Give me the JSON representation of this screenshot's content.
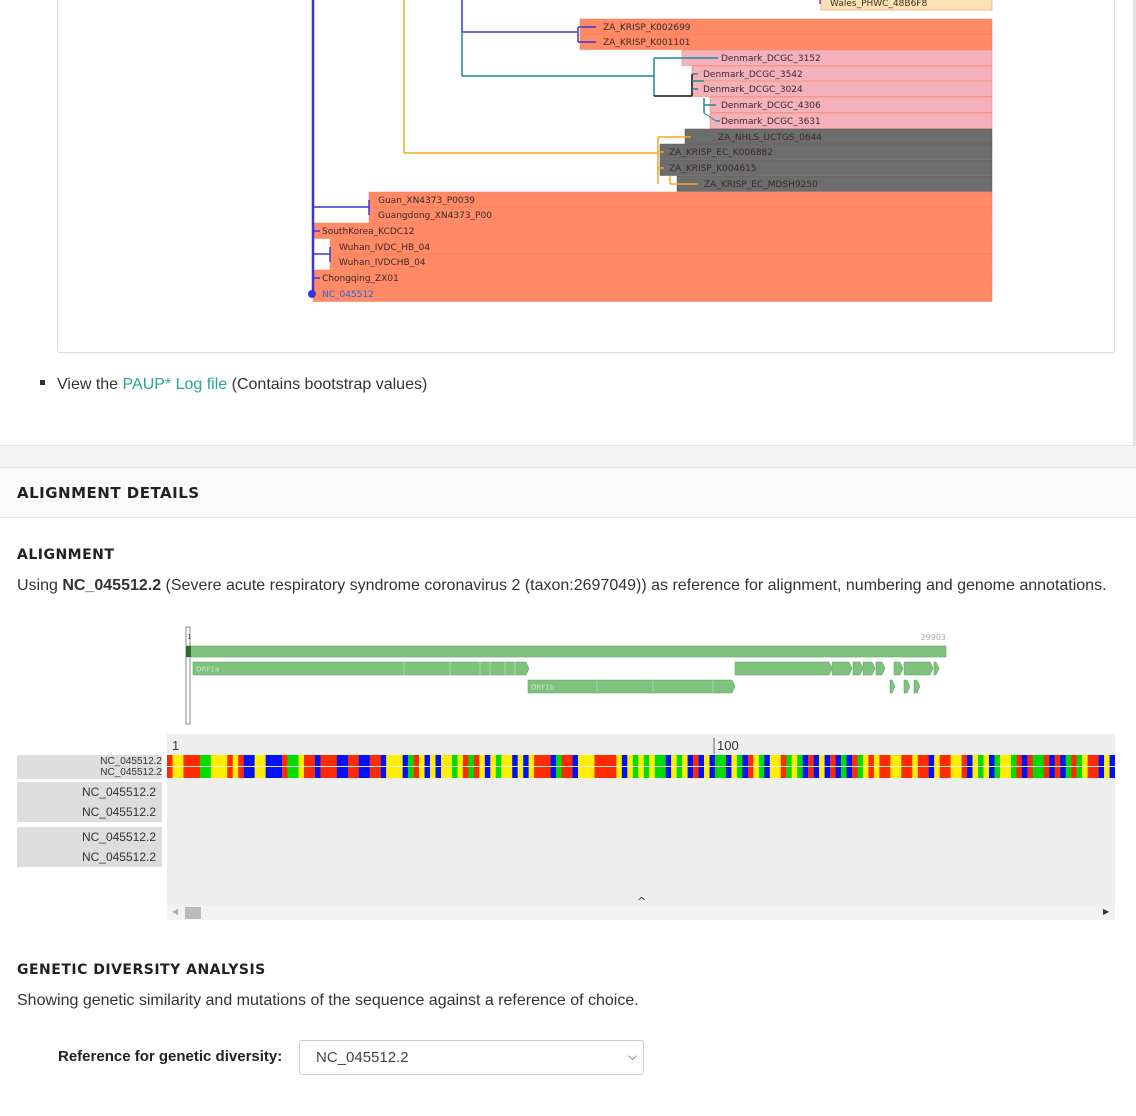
{
  "tree": {
    "leaves": [
      {
        "label": "Wales_PHWC_48B6F8",
        "color": "#fde3b0"
      },
      {
        "label": "ZA_KRISP_K002699",
        "color": "#ff8a65"
      },
      {
        "label": "ZA_KRISP_K001101",
        "color": "#ff8a65"
      },
      {
        "label": "Denmark_DCGC_3152",
        "color": "#f4b1bb"
      },
      {
        "label": "Denmark_DCGC_3542",
        "color": "#f4b1bb"
      },
      {
        "label": "Denmark_DCGC_3024",
        "color": "#f4b1bb"
      },
      {
        "label": "Denmark_DCGC_4306",
        "color": "#f4b1bb"
      },
      {
        "label": "Denmark_DCGC_3631",
        "color": "#f4b1bb"
      },
      {
        "label": "ZA_NHLS_UCTGS_0644",
        "color": "#6d6d6d"
      },
      {
        "label": "ZA_KRISP_EC_K006882",
        "color": "#6d6d6d"
      },
      {
        "label": "ZA_KRISP_K004615",
        "color": "#6d6d6d"
      },
      {
        "label": "ZA_KRISP_EC_MDSH9250",
        "color": "#6d6d6d"
      },
      {
        "label": "Guan_XN4373_P0039",
        "color": "#ff8a65"
      },
      {
        "label": "Guangdong_XN4373_P00",
        "color": "#ff8a65"
      },
      {
        "label": "SouthKorea_KCDC12",
        "color": "#ff8a65"
      },
      {
        "label": "Wuhan_IVDC_HB_04",
        "color": "#ff8a65"
      },
      {
        "label": "Wuhan_IVDCHB_04",
        "color": "#ff8a65"
      },
      {
        "label": "Chongqing_ZX01",
        "color": "#ff8a65"
      },
      {
        "label": "NC_045512",
        "color": "#ff8a65"
      }
    ]
  },
  "paup": {
    "prefix": "View the ",
    "link": "PAUP* Log file",
    "suffix": " (Contains bootstrap values)"
  },
  "alignment_details": {
    "header": "ALIGNMENT DETAILS",
    "alignment_title": "ALIGNMENT",
    "desc_prefix": "Using ",
    "desc_ref": "NC_045512.2",
    "desc_suffix": " (Severe acute respiratory syndrome coronavirus 2 (taxon:2697049)) as reference for alignment, numbering and genome annotations."
  },
  "genome_map": {
    "start_label": "1",
    "end_label": "29903",
    "genes": [
      "ORF1a",
      "ORF1b"
    ]
  },
  "msa": {
    "ruler_start": "1",
    "ruler_mark": "100",
    "labels_small": [
      "NC_045512.2",
      "NC_045512.2"
    ],
    "labels": [
      "NC_045512.2",
      "NC_045512.2",
      "NC_045512.2",
      "NC_045512.2"
    ],
    "caret": "^",
    "sequence": "ATTAAAGGTTTATACCTTCCCAGGTAACAAACCAACCAACTTTCGATCTCTTGTAGATCTGTTCTCTAAACGAACTTTAAAATCTGTGTGGCTGTCACTCGGCTGCATGCTTAGTGCACTCACGCAGTATAATTAATAACTAATTACTGTCGTTGACAGGACACGAGTAACTCGTCTATCTTCTGCAGGCTGCTTACGGTTTCGTCCGTGTTGCAGCCGATCATCAGCACATCTAGGTTTCGTCCGGGTGTGACCGAAAGGTAAGATGGAGAGCCTTGTCCCTGGTTTCAACGAGAAAACACACGTCCAACTCAGTTTGCCTGTTTTACAGGTTCGCGACGTGCTCGTACGTGGCTTTGGAGACTCCGTGGAGGAGGTCTTATCAGAGGCACGTCAACATCTTAAAGATGGCACTTGTGGCTTAGTAGAAGTTGAAAAAGGCGTTTTGCCTCAACTTGAACAGCCCTATGTGTTCATCAAACGTTCGGATGCTCGAACTGCACCTCATGGTCATGTTATGGTTGAGCTGGTAGCAGAACTCGAAGGCATTCAGTACGGTCGTAGTGGTGAGACACTTGGTGTCCTTGTCCCTCATGTGGGCGAAATACCAGTGGCTTACCGCAAGGTTCTTCTTCGTAAGAACGGTAATAAAGGAGCTGGTGGCCATAGTTACGGCGCCGATCTAAAGTCATTTGACTTAGGCGACGAGCTTGGCACTGATCCTTATGAAGATTTTCAAGAAAACTGGAACACTAAACATAGCAGTGGTGTTACCCGTGAACTCATGCGTGAGCTTAACGGAGGGGCATACACTCGCTATGTCGATAACAACTTCTGTGGCCCTGATGGCTACCCTCTTGAGTGCATTAAAGACCTTCTAGCACGTGCTGGTAAAGCTTCATGCACTTTGTCCGAACAACTGGACTTTATTGACACTAAGAGGGGTGTATACTGCTGCCGTGAACATGAGCATGAAATTGCTTGGTACACGGAACGTTCTGAAAAGAGCTATGAATTGCAGACACCTTTTGAAATTAAATTGGCAAAGAAATTTGACACCTTCAATGGGGAATGTCCAAATTTTGTATTTCCCTTAAATTCCATAATCAAGACTATTCAACCAAGGGTTGAAAAGAAAAAGCTTGATGGCTTTATGGGTAGAATTCGATCTGTCTATCCAGTTGCGTCACCAAATGAATGCAACCAAATGTGCCTTTCAACTCTCATGAAGTGTGATCATTGTGGTGAAACTTCATGGCAGACGGGCGATTTTGTTAAAGCCACTTGCGAATTTTGTGGCACTGAGAATTTGACTAAAGAAGGTGCCACTACTTGTGGTTACTTACCCCAAAATGCTGTTGTTAAAATTTATTGTCCAGCATGTCACAATTCAGAAGTAGGACCTGAGCATAGTCTTGCCGAATACCATAATGAATCTGGCTTGAAAACCATTCTTCGTAAGGGTGGTCGCACTATTGCCTTTGGAGGCTGTGTGTTCTCTTATGTTGGTTGCCATAACAAGTGTGCCTATTGGGTTCCACGTGCTAGCGCTAACATAGGTTGTAACCATACAGGTGTTGTTGGAGAAGGTTCCGAAGGTCTTAATGACAACCTTCTTGAAATACTCCAAAAAGAGAAAGTCAACATCAATATTGTTGGTGACTTTAAACTTAATGAAGAGATCGCCATTATTTTGGCATCTTTTTCTGCTTCCACAAGTGCTTTTGTGGAAACTGTGAAAGGTTTGGATTATAAAGCATTCAAACAAATTGTTGAATCCTGCGGTAATTTTAAAGTTACAAAAGGAAAAGCTAAAAAAGGTGCCTGGAATATTGGTGAACAGAAATCAATACTGAGTCCTCTTTATGCATTTGCATCAGAGGCTGCTCGTGTTGTACGATCAATTTTCTCCCGCACTCTTGAAACTGCTCAAAATTCTGTGCGTGTTTTACAGAAGGCCGCTATAACAATACTAGATGGAATTTCACAGTATTCACTGAGACTCATTGATGCTATGATGTTCACATCTGATTTGGCTACTAACAATCTAGTTGTAATGGCCTACATTACAGGTGGTGTTGTTCAGTTGACTTCGCAGTGGCTAACTAACATCTTTGGCACTGTTTATGAAAAACTCAAACCCGTCCTTGATTGGCTTGAAGAGAAGTTTAAGGAAGGTGTAGAGTTTCTTAGAGACGGTTGGGAAATTGTTAAATTTATCTCAACCTGTGCTTGTGAAATTGTCGGTGGACAAATTGTCACCTGTGCAAAGGAAATTAAGGAGAGTGTTCAGACATTCTTTAAGCTTGTAAATAAATTTTTGGCTTTGTGTGCTGACTCTATCATTATTGGTGGAGCTAAACTTAAAGCCTTGAATTTAGGTGAAACATTTGTCACGCACTCAAAGGGATTGTACAGAAAGTGTGTTAAATCCAGAGAAGAAACTGGCCTACTCATGCCTCTAAAAGCCCCAAAAGAAATTATCTTCTTAGAGGGAGAAACACTTCCCACAGAAGTGTTAACAGAGGAAGTTGTCTTGAAAACTGGTGATTTACAACCATTAGAACAACCTACTAGTGAAGCTGTTGAAGCTCCATTGGTTGGTACACCAGTTTGTATTAACGGGCTTATGTTGCTCGAAATCAAAGACACAGAAAAGTACTGTGCCCTTGCACCTAATATGATGGTAACAAACAATACCTTCACACTCAAAGGCGG"
  },
  "diversity": {
    "title": "GENETIC DIVERSITY ANALYSIS",
    "desc": "Showing genetic similarity and mutations of the sequence against a reference of choice.",
    "ref_label": "Reference for genetic diversity:",
    "ref_value": "NC_045512.2"
  },
  "colors": {
    "A": "#ff2a00",
    "C": "#0010ff",
    "G": "#00dd00",
    "T": "#ffee00",
    "accent": "#26a69a",
    "gene": "#7ec27e"
  }
}
